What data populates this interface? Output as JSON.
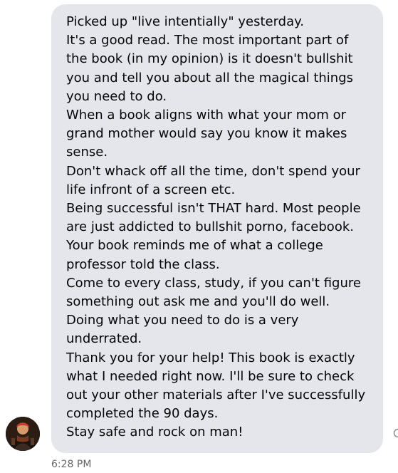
{
  "message": {
    "lines": [
      "Picked up \"live intentially\" yesterday.",
      "It's a good read. The most important part of",
      "the book (in my opinion) is it doesn't bullshit",
      "you and tell you about all the magical things",
      "you need to do.",
      "When a book aligns with what your mom or",
      "grand mother would say you know it makes",
      "sense.",
      "Don't whack off all the time, don't spend your",
      "life infront of a screen etc.",
      "Being successful isn't THAT hard. Most people",
      "are just addicted to bullshit porno, facebook.",
      "Your book reminds me of what a college",
      "professor told the class.",
      "Come to every class, study, if you can't figure",
      "something out ask me and you'll do well.",
      "Doing what you need to do is a very",
      "underrated.",
      "Thank you for your help! This book is exactly",
      "what I needed right now. I'll be sure to check",
      "out your other materials after I've successfully",
      "completed the 90 days.",
      "Stay safe and rock on man!"
    ],
    "timestamp": "6:28 PM"
  },
  "colors": {
    "bubble_background": "#e4e6eb",
    "text": "#050505",
    "timestamp": "#65676b"
  },
  "icons": {
    "avatar": "sender-avatar",
    "edge": "react-icon"
  }
}
